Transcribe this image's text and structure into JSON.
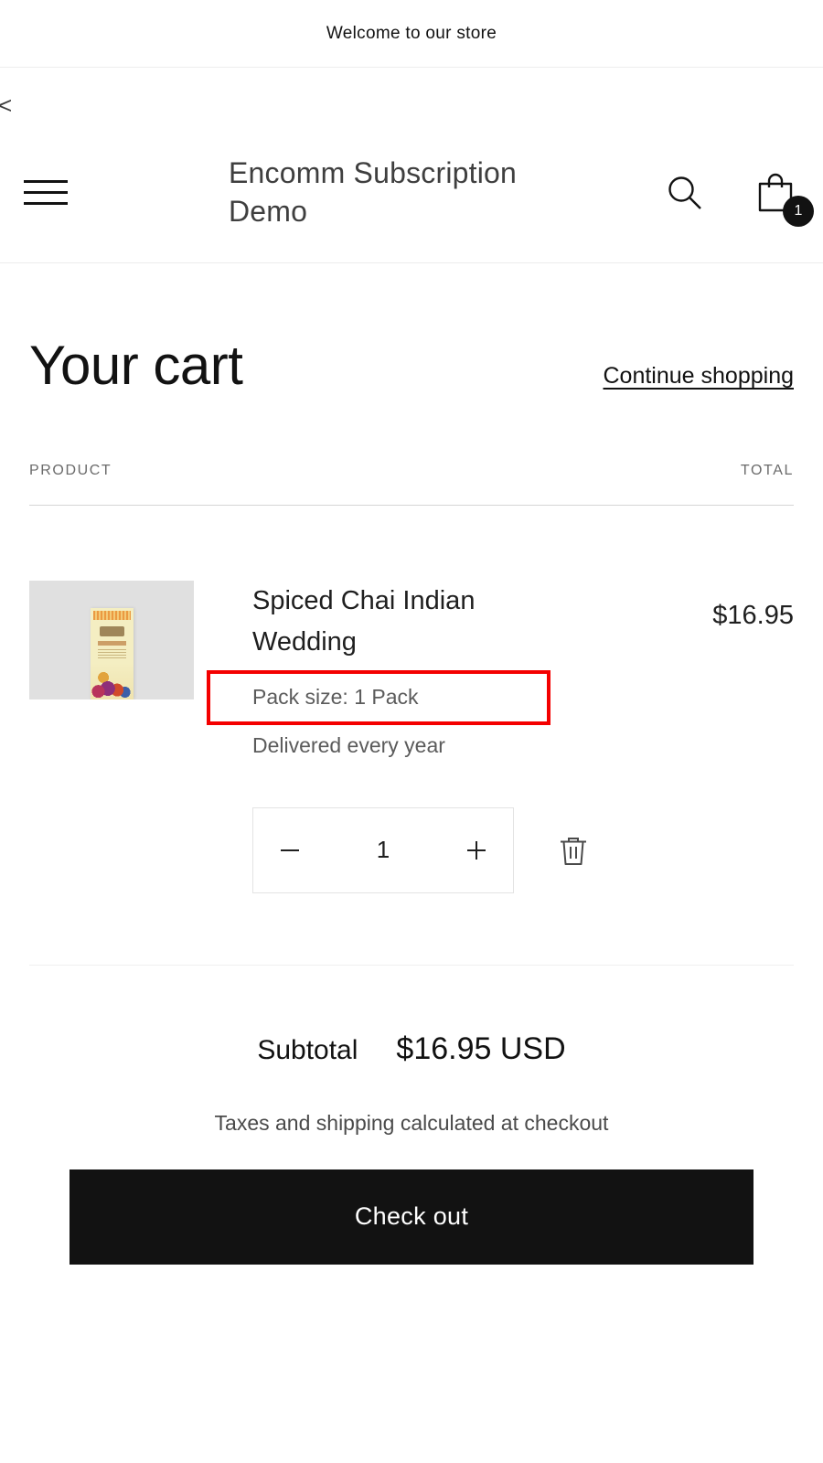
{
  "announcement": {
    "text": "Welcome to our store"
  },
  "browser": {
    "back_label": "<"
  },
  "header": {
    "menu_label": "Menu",
    "store_title": "Encomm Subscription Demo",
    "search_label": "Search",
    "cart_label": "Cart",
    "cart_count": "1"
  },
  "cart": {
    "title": "Your cart",
    "continue_shopping": "Continue shopping",
    "columns": {
      "product": "PRODUCT",
      "total": "TOTAL"
    },
    "items": [
      {
        "title": "Spiced Chai Indian Wedding",
        "option": "Pack size: 1 Pack",
        "selling_plan": "Delivered every year",
        "price": "$16.95",
        "quantity": "1",
        "decrease_label": "−",
        "increase_label": "+",
        "remove_label": "Remove"
      }
    ],
    "subtotal_label": "Subtotal",
    "subtotal_value": "$16.95 USD",
    "tax_note": "Taxes and shipping calculated at checkout",
    "checkout_label": "Check out"
  },
  "colors": {
    "highlight": "#f40000",
    "accent": "#121212",
    "muted_text": "#5b5b5b",
    "divider": "#d5d5d5"
  }
}
